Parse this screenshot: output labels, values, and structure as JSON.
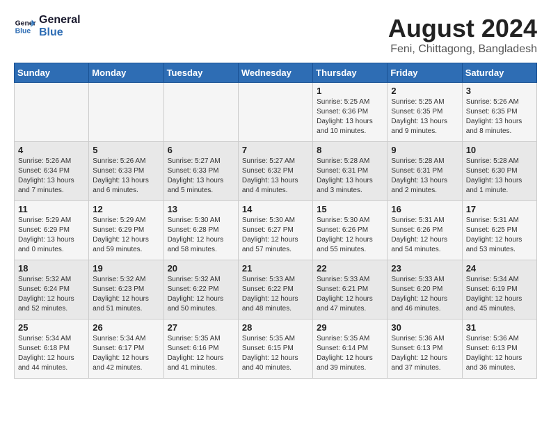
{
  "header": {
    "logo_line1": "General",
    "logo_line2": "Blue",
    "title": "August 2024",
    "subtitle": "Feni, Chittagong, Bangladesh"
  },
  "weekdays": [
    "Sunday",
    "Monday",
    "Tuesday",
    "Wednesday",
    "Thursday",
    "Friday",
    "Saturday"
  ],
  "weeks": [
    [
      {
        "day": "",
        "info": ""
      },
      {
        "day": "",
        "info": ""
      },
      {
        "day": "",
        "info": ""
      },
      {
        "day": "",
        "info": ""
      },
      {
        "day": "1",
        "info": "Sunrise: 5:25 AM\nSunset: 6:36 PM\nDaylight: 13 hours\nand 10 minutes."
      },
      {
        "day": "2",
        "info": "Sunrise: 5:25 AM\nSunset: 6:35 PM\nDaylight: 13 hours\nand 9 minutes."
      },
      {
        "day": "3",
        "info": "Sunrise: 5:26 AM\nSunset: 6:35 PM\nDaylight: 13 hours\nand 8 minutes."
      }
    ],
    [
      {
        "day": "4",
        "info": "Sunrise: 5:26 AM\nSunset: 6:34 PM\nDaylight: 13 hours\nand 7 minutes."
      },
      {
        "day": "5",
        "info": "Sunrise: 5:26 AM\nSunset: 6:33 PM\nDaylight: 13 hours\nand 6 minutes."
      },
      {
        "day": "6",
        "info": "Sunrise: 5:27 AM\nSunset: 6:33 PM\nDaylight: 13 hours\nand 5 minutes."
      },
      {
        "day": "7",
        "info": "Sunrise: 5:27 AM\nSunset: 6:32 PM\nDaylight: 13 hours\nand 4 minutes."
      },
      {
        "day": "8",
        "info": "Sunrise: 5:28 AM\nSunset: 6:31 PM\nDaylight: 13 hours\nand 3 minutes."
      },
      {
        "day": "9",
        "info": "Sunrise: 5:28 AM\nSunset: 6:31 PM\nDaylight: 13 hours\nand 2 minutes."
      },
      {
        "day": "10",
        "info": "Sunrise: 5:28 AM\nSunset: 6:30 PM\nDaylight: 13 hours\nand 1 minute."
      }
    ],
    [
      {
        "day": "11",
        "info": "Sunrise: 5:29 AM\nSunset: 6:29 PM\nDaylight: 13 hours\nand 0 minutes."
      },
      {
        "day": "12",
        "info": "Sunrise: 5:29 AM\nSunset: 6:29 PM\nDaylight: 12 hours\nand 59 minutes."
      },
      {
        "day": "13",
        "info": "Sunrise: 5:30 AM\nSunset: 6:28 PM\nDaylight: 12 hours\nand 58 minutes."
      },
      {
        "day": "14",
        "info": "Sunrise: 5:30 AM\nSunset: 6:27 PM\nDaylight: 12 hours\nand 57 minutes."
      },
      {
        "day": "15",
        "info": "Sunrise: 5:30 AM\nSunset: 6:26 PM\nDaylight: 12 hours\nand 55 minutes."
      },
      {
        "day": "16",
        "info": "Sunrise: 5:31 AM\nSunset: 6:26 PM\nDaylight: 12 hours\nand 54 minutes."
      },
      {
        "day": "17",
        "info": "Sunrise: 5:31 AM\nSunset: 6:25 PM\nDaylight: 12 hours\nand 53 minutes."
      }
    ],
    [
      {
        "day": "18",
        "info": "Sunrise: 5:32 AM\nSunset: 6:24 PM\nDaylight: 12 hours\nand 52 minutes."
      },
      {
        "day": "19",
        "info": "Sunrise: 5:32 AM\nSunset: 6:23 PM\nDaylight: 12 hours\nand 51 minutes."
      },
      {
        "day": "20",
        "info": "Sunrise: 5:32 AM\nSunset: 6:22 PM\nDaylight: 12 hours\nand 50 minutes."
      },
      {
        "day": "21",
        "info": "Sunrise: 5:33 AM\nSunset: 6:22 PM\nDaylight: 12 hours\nand 48 minutes."
      },
      {
        "day": "22",
        "info": "Sunrise: 5:33 AM\nSunset: 6:21 PM\nDaylight: 12 hours\nand 47 minutes."
      },
      {
        "day": "23",
        "info": "Sunrise: 5:33 AM\nSunset: 6:20 PM\nDaylight: 12 hours\nand 46 minutes."
      },
      {
        "day": "24",
        "info": "Sunrise: 5:34 AM\nSunset: 6:19 PM\nDaylight: 12 hours\nand 45 minutes."
      }
    ],
    [
      {
        "day": "25",
        "info": "Sunrise: 5:34 AM\nSunset: 6:18 PM\nDaylight: 12 hours\nand 44 minutes."
      },
      {
        "day": "26",
        "info": "Sunrise: 5:34 AM\nSunset: 6:17 PM\nDaylight: 12 hours\nand 42 minutes."
      },
      {
        "day": "27",
        "info": "Sunrise: 5:35 AM\nSunset: 6:16 PM\nDaylight: 12 hours\nand 41 minutes."
      },
      {
        "day": "28",
        "info": "Sunrise: 5:35 AM\nSunset: 6:15 PM\nDaylight: 12 hours\nand 40 minutes."
      },
      {
        "day": "29",
        "info": "Sunrise: 5:35 AM\nSunset: 6:14 PM\nDaylight: 12 hours\nand 39 minutes."
      },
      {
        "day": "30",
        "info": "Sunrise: 5:36 AM\nSunset: 6:13 PM\nDaylight: 12 hours\nand 37 minutes."
      },
      {
        "day": "31",
        "info": "Sunrise: 5:36 AM\nSunset: 6:13 PM\nDaylight: 12 hours\nand 36 minutes."
      }
    ]
  ]
}
